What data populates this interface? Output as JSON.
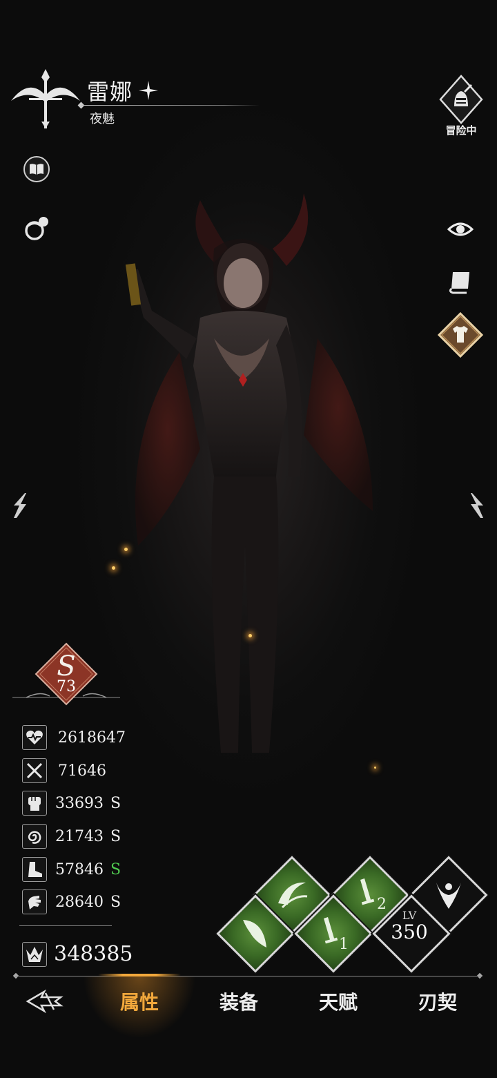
{
  "hero": {
    "name": "雷娜",
    "title": "夜魅",
    "status_label": "冒险中",
    "grade_letter": "S",
    "grade_number": "73"
  },
  "stats": [
    {
      "icon": "heart-icon",
      "value": "2618647",
      "grade": ""
    },
    {
      "icon": "crossed-swords-icon",
      "value": "71646",
      "grade": ""
    },
    {
      "icon": "fist-icon",
      "value": "33693",
      "grade": "S"
    },
    {
      "icon": "swirl-icon",
      "value": "21743",
      "grade": "S"
    },
    {
      "icon": "boot-icon",
      "value": "57846",
      "grade": "S"
    },
    {
      "icon": "hand-icon",
      "value": "28640",
      "grade": "S"
    }
  ],
  "power": {
    "icon": "crown-icon",
    "value": "348385"
  },
  "skills": {
    "level_label": "LV",
    "level_value": "350",
    "skill_1_num": "1",
    "skill_2_num": "2"
  },
  "nav": {
    "items": [
      "属性",
      "装备",
      "天赋",
      "刃契"
    ],
    "active_index": 0
  },
  "colors": {
    "accent": "#f2a83c",
    "grade_green": "#4fc84f",
    "grade_badge": "#8c3526",
    "skill_green": "#4a7d2e"
  }
}
